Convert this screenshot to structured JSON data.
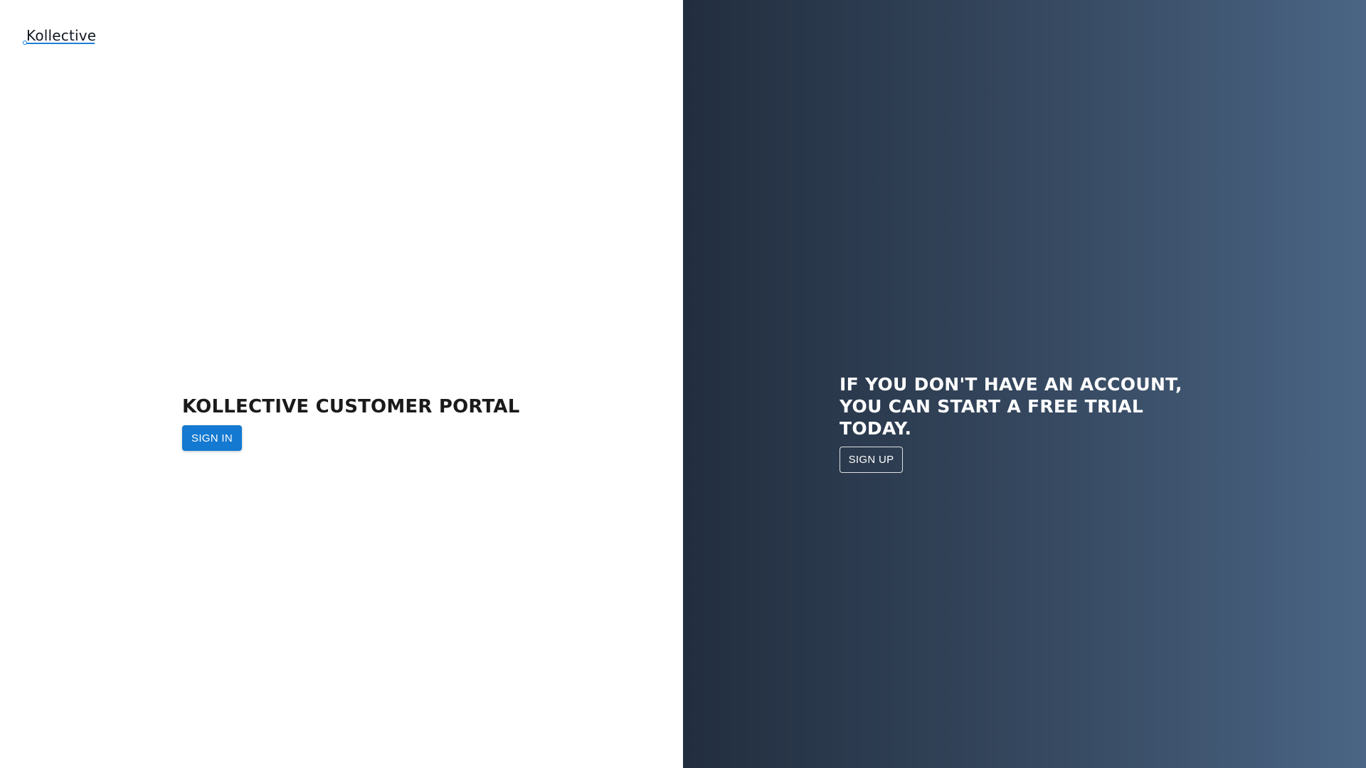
{
  "logo": {
    "text": "Kollective"
  },
  "left": {
    "title": "KOLLECTIVE CUSTOMER PORTAL",
    "signin_label": "SIGN IN"
  },
  "right": {
    "message": "IF YOU DON'T HAVE AN ACCOUNT, YOU CAN START A FREE TRIAL TODAY.",
    "signup_label": "SIGN UP"
  },
  "colors": {
    "brand_blue": "#1479d1",
    "panel_dark_start": "#222e3f",
    "panel_dark_end": "#4a6585"
  }
}
